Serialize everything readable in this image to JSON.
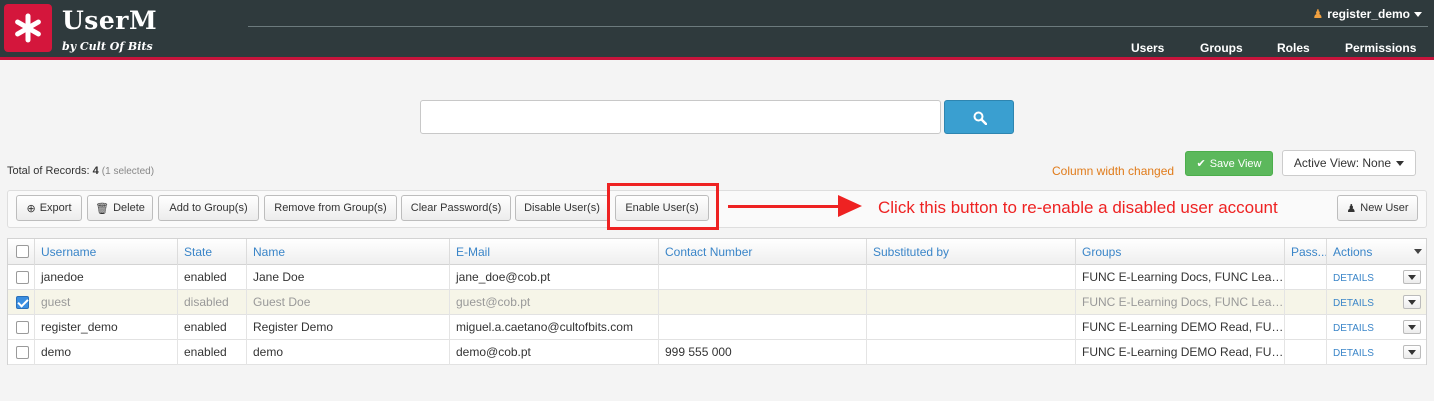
{
  "header": {
    "brand": "UserM",
    "brand_sub": "by Cult Of Bits",
    "user": "register_demo",
    "nav": [
      "Users",
      "Groups",
      "Roles",
      "Permissions"
    ]
  },
  "search": {
    "value": "",
    "placeholder": ""
  },
  "records": {
    "label": "Total of Records:",
    "count": "4",
    "selected": "(1 selected)"
  },
  "column_notice": "Column width changed",
  "save_view": "Save View",
  "active_view": "Active View: None",
  "toolbar": {
    "export": "Export",
    "delete": "Delete",
    "add_to_group": "Add to Group(s)",
    "remove_from_group": "Remove from Group(s)",
    "clear_password": "Clear Password(s)",
    "disable_users": "Disable User(s)",
    "enable_users": "Enable User(s)",
    "new_user": "New User"
  },
  "annotation": "Click this button to re-enable a disabled user account",
  "table": {
    "columns": [
      "Username",
      "State",
      "Name",
      "E-Mail",
      "Contact Number",
      "Substituted by",
      "Groups",
      "Pass...",
      "Actions"
    ],
    "rows": [
      {
        "username": "janedoe",
        "state": "enabled",
        "name": "Jane Doe",
        "email": "jane_doe@cob.pt",
        "contact": "",
        "substituted": "",
        "groups": "FUNC E-Learning Docs, FUNC Learn...",
        "action": "DETAILS",
        "checked": false
      },
      {
        "username": "guest",
        "state": "disabled",
        "name": "Guest Doe",
        "email": "guest@cob.pt",
        "contact": "",
        "substituted": "",
        "groups": "FUNC E-Learning Docs, FUNC Learn...",
        "action": "DETAILS",
        "checked": true
      },
      {
        "username": "register_demo",
        "state": "enabled",
        "name": "Register Demo",
        "email": "miguel.a.caetano@cultofbits.com",
        "contact": "",
        "substituted": "",
        "groups": "FUNC E-Learning DEMO Read, FUN...",
        "action": "DETAILS",
        "checked": false
      },
      {
        "username": "demo",
        "state": "enabled",
        "name": "demo",
        "email": "demo@cob.pt",
        "contact": "999 555 000",
        "substituted": "",
        "groups": "FUNC E-Learning DEMO Read, FUN...",
        "action": "DETAILS",
        "checked": false
      }
    ]
  },
  "colors": {
    "header_bg": "#2f3a3d",
    "brand_red": "#d4163c",
    "link_blue": "#3a85c8",
    "save_green": "#5cb85c",
    "notice_orange": "#e07b1a",
    "annotation_red": "#ee2222"
  }
}
